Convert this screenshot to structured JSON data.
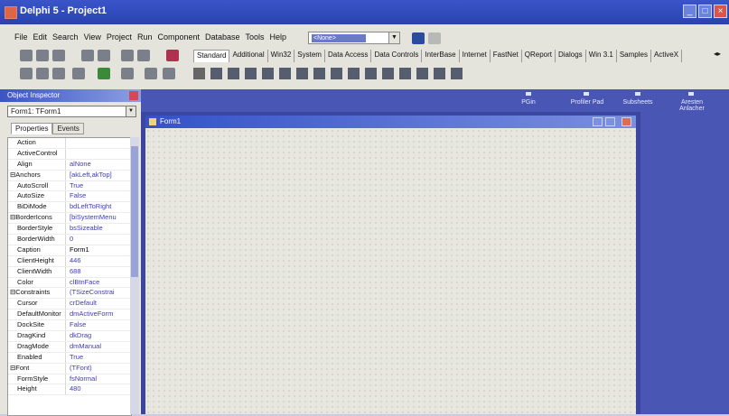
{
  "window": {
    "title": "Delphi 5 - Project1",
    "min": "_",
    "max": "□",
    "close": "×"
  },
  "menu": [
    "File",
    "Edit",
    "Search",
    "View",
    "Project",
    "Run",
    "Component",
    "Database",
    "Tools",
    "Help"
  ],
  "desktop_combo": {
    "value": "<None>"
  },
  "palette_tabs": [
    "Standard",
    "Additional",
    "Win32",
    "System",
    "Data Access",
    "Data Controls",
    "InterBase",
    "Internet",
    "FastNet",
    "QReport",
    "Dialogs",
    "Win 3.1",
    "Samples",
    "ActiveX"
  ],
  "palette_active": "Standard",
  "right_dock": {
    "items": [
      "PGin",
      "Profiler Pad",
      "Subsheets",
      "Aresten Anlacher"
    ]
  },
  "object_inspector": {
    "title": "Object Inspector",
    "selected_object": "Form1: TForm1",
    "tabs": [
      "Properties",
      "Events"
    ],
    "properties": [
      {
        "name": "Action",
        "value": "",
        "group": false
      },
      {
        "name": "ActiveControl",
        "value": "",
        "group": false
      },
      {
        "name": "Align",
        "value": "alNone",
        "group": false
      },
      {
        "name": "⊟Anchors",
        "value": "[akLeft,akTop]",
        "group": true
      },
      {
        "name": "AutoScroll",
        "value": "True",
        "group": false
      },
      {
        "name": "AutoSize",
        "value": "False",
        "group": false
      },
      {
        "name": "BiDiMode",
        "value": "bdLeftToRight",
        "group": false
      },
      {
        "name": "⊟BorderIcons",
        "value": "[biSystemMenu",
        "group": true
      },
      {
        "name": "BorderStyle",
        "value": "bsSizeable",
        "group": false
      },
      {
        "name": "BorderWidth",
        "value": "0",
        "group": false
      },
      {
        "name": "Caption",
        "value": "Form1",
        "group": false,
        "selected": true
      },
      {
        "name": "ClientHeight",
        "value": "446",
        "group": false
      },
      {
        "name": "ClientWidth",
        "value": "688",
        "group": false
      },
      {
        "name": "Color",
        "value": "clBtnFace",
        "group": false
      },
      {
        "name": "⊟Constraints",
        "value": "(TSizeConstrai",
        "group": true
      },
      {
        "name": "Cursor",
        "value": "crDefault",
        "group": false
      },
      {
        "name": "DefaultMonitor",
        "value": "dmActiveForm",
        "group": false
      },
      {
        "name": "DockSite",
        "value": "False",
        "group": false
      },
      {
        "name": "DragKind",
        "value": "dkDrag",
        "group": false
      },
      {
        "name": "DragMode",
        "value": "dmManual",
        "group": false
      },
      {
        "name": "Enabled",
        "value": "True",
        "group": false
      },
      {
        "name": "⊟Font",
        "value": "(TFont)",
        "group": true
      },
      {
        "name": "FormStyle",
        "value": "fsNormal",
        "group": false
      },
      {
        "name": "Height",
        "value": "480",
        "group": false
      }
    ]
  },
  "form": {
    "caption": "Form1"
  },
  "colors": {
    "titlebar": "#2f4bbf",
    "form_canvas": "#e7e6df",
    "dock": "#4a56b4"
  }
}
